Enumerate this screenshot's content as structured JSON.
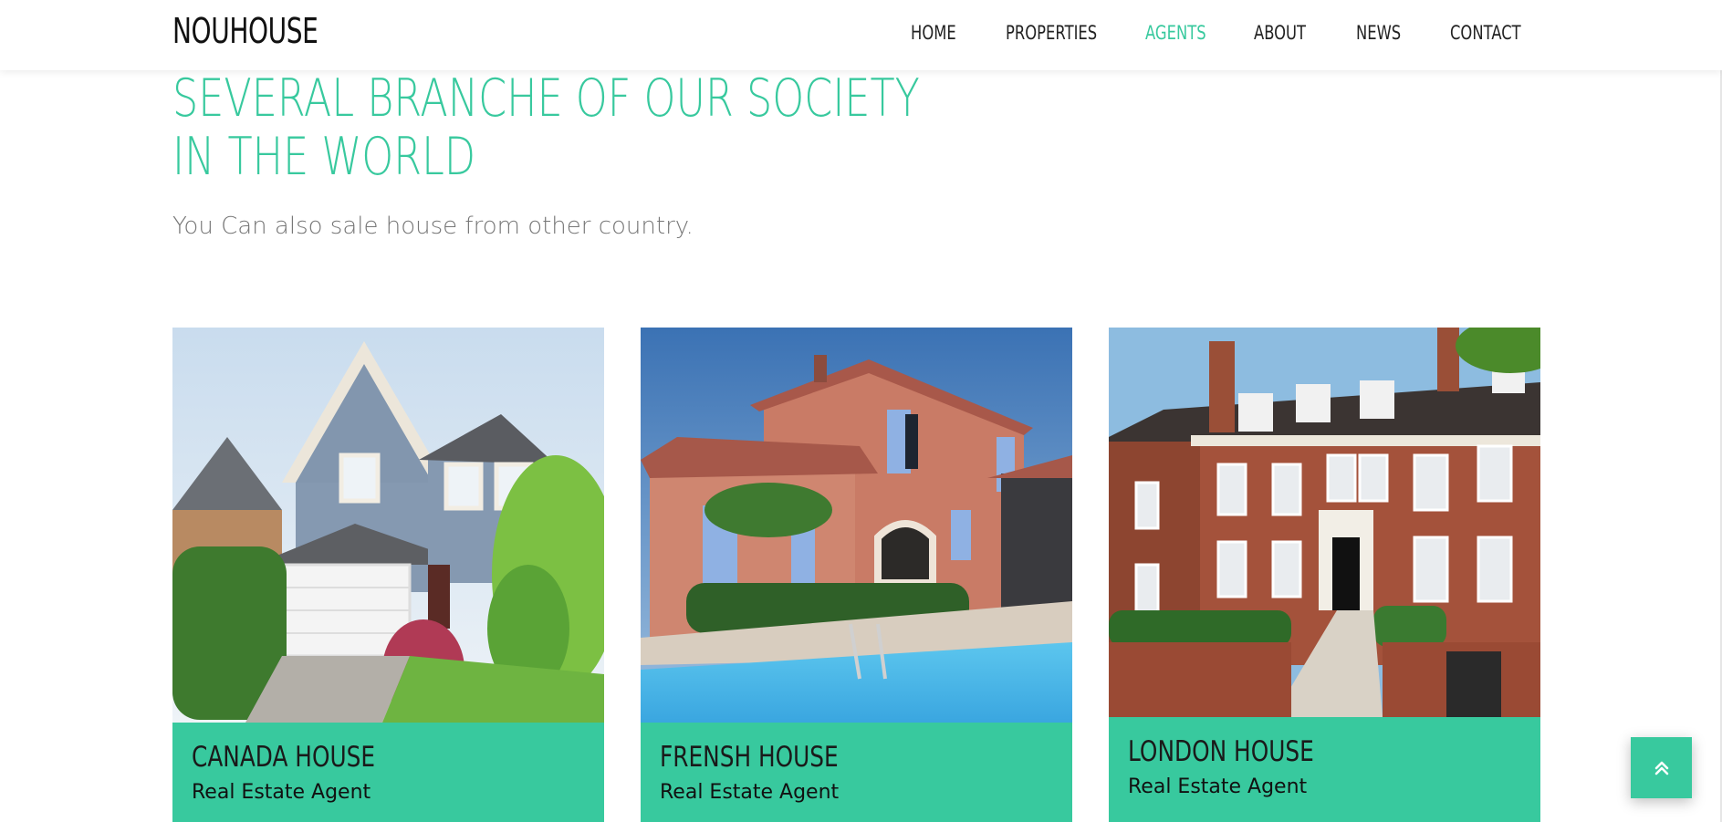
{
  "header": {
    "brand": "NOUHOUSE",
    "nav": [
      {
        "label": "HOME",
        "active": false
      },
      {
        "label": "PROPERTIES",
        "active": false
      },
      {
        "label": "AGENTS",
        "active": true
      },
      {
        "label": "ABOUT",
        "active": false
      },
      {
        "label": "NEWS",
        "active": false
      },
      {
        "label": "CONTACT",
        "active": false
      }
    ]
  },
  "hero": {
    "title": "SEVERAL BRANCHE OF OUR SOCIETY IN THE WORLD",
    "subtitle": "You Can also sale house from other country."
  },
  "cards": [
    {
      "name": "CANADA HOUSE",
      "role": "Real Estate Agent",
      "image": "suburban-blue-house-photo"
    },
    {
      "name": "FRENSH HOUSE",
      "role": "Real Estate Agent",
      "image": "provencal-villa-pool-photo"
    },
    {
      "name": "LONDON HOUSE",
      "role": "Real Estate Agent",
      "image": "brick-townhouse-photo"
    }
  ],
  "colors": {
    "accent": "#38c99e",
    "text": "#222222",
    "muted": "#777777"
  },
  "back_to_top": {
    "icon": "double-chevron-up-icon"
  }
}
